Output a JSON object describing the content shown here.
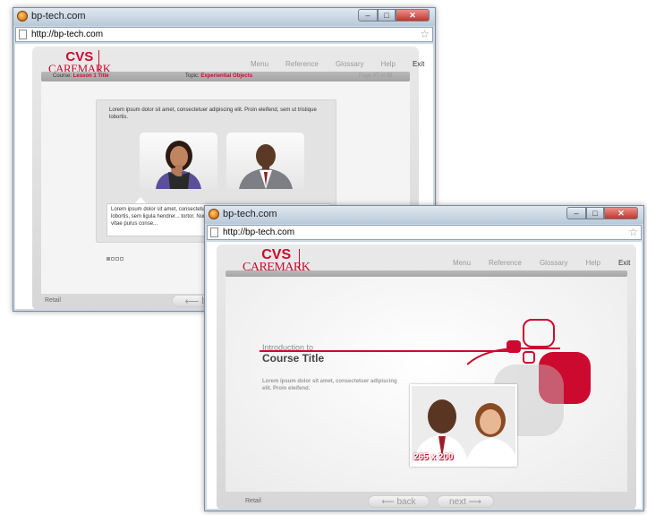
{
  "browser": {
    "title": "bp-tech.com",
    "url": "http://bp-tech.com",
    "min_glyph": "–",
    "max_glyph": "□",
    "close_glyph": "✕"
  },
  "brand": {
    "line1": "CVS",
    "line2": "CAREMARK"
  },
  "nav": {
    "menu": "Menu",
    "reference": "Reference",
    "glossary": "Glossary",
    "help": "Help",
    "exit": "Exit"
  },
  "slide1": {
    "course_label": "Course:",
    "course_value": "Lesson 1 Title",
    "topic_label": "Topic:",
    "topic_value": "Experiential Objects",
    "page_text": "Page 37 of 88",
    "intro_text": "Lorem ipsum dolor sit amet, consectetuer adipiscing elit. Proin eleifend, sem ut tristique lobortis.",
    "bubble_text": "Lorem ipsum dolor sit amet, consectetuer adipiscing elit. Proin eleifend, sem ut tristique lobortis,  sem ligula hendrer... tortor. Nunc fermentum feugiat nibh... Praesent ac lorem vitae purus conse...",
    "pager_total": 4,
    "pager_current": 1,
    "footer_label": "Retail",
    "back_label": "ba"
  },
  "slide2": {
    "intro_label": "Introduction to",
    "course_title": "Course Title",
    "body_text": "Lorem ipsum dolor sit amet, consectetuer adipiscing elit. Proin eleifend.",
    "image_size_label": "265 x 200",
    "footer_label": "Retail",
    "back_label": "back",
    "next_label": "next"
  },
  "colors": {
    "brand_red": "#cc0a2f",
    "frame_grey": "#d9d9d9",
    "text_grey": "#9a9a9a"
  },
  "icons": {
    "back_arrow": "⟵",
    "next_arrow": "⟶"
  }
}
